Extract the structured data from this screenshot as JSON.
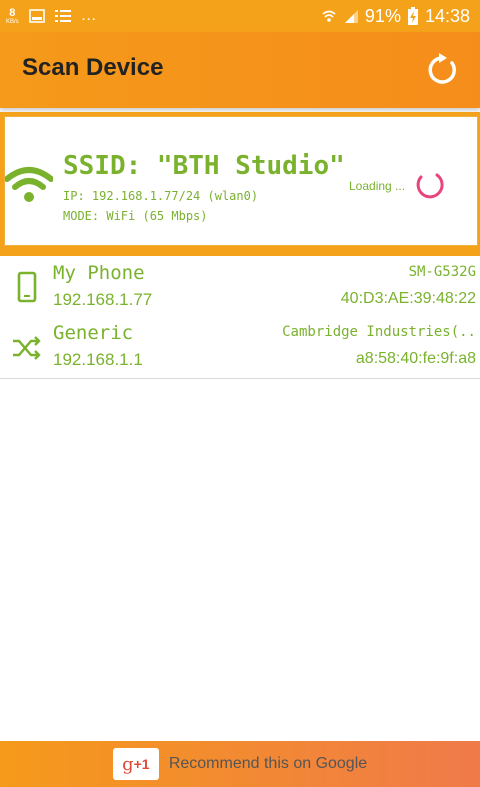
{
  "status_bar": {
    "speed_value": "8",
    "speed_unit": "KB/s",
    "battery": "91%",
    "time": "14:38",
    "icons": [
      "download-icon",
      "notification-icon",
      "more-icon",
      "wifi-icon",
      "signal-icon",
      "battery-charging-icon"
    ]
  },
  "app_bar": {
    "title": "Scan Device",
    "refresh_icon": "refresh-icon"
  },
  "network": {
    "ssid_label": "SSID: \"BTH Studio\"",
    "ip_line": "IP: 192.168.1.77/24 (wlan0)",
    "mode_line": "MODE: WiFi (65 Mbps)",
    "loading_text": "Loading ...",
    "accent_color": "#7ab22e",
    "spinner_color": "#e8457a"
  },
  "devices": [
    {
      "name": "My Phone",
      "ip": "192.168.1.77",
      "vendor": "SM-G532G",
      "mac": "40:D3:AE:39:48:22",
      "icon": "smartphone-icon"
    },
    {
      "name": "Generic",
      "ip": "192.168.1.1",
      "vendor": "Cambridge Industries(..",
      "mac": "a8:58:40:fe:9f:a8",
      "icon": "shuffle-icon"
    }
  ],
  "banner": {
    "gplus_g": "g",
    "gplus_plus": "+1",
    "text": "Recommend this on Google"
  }
}
